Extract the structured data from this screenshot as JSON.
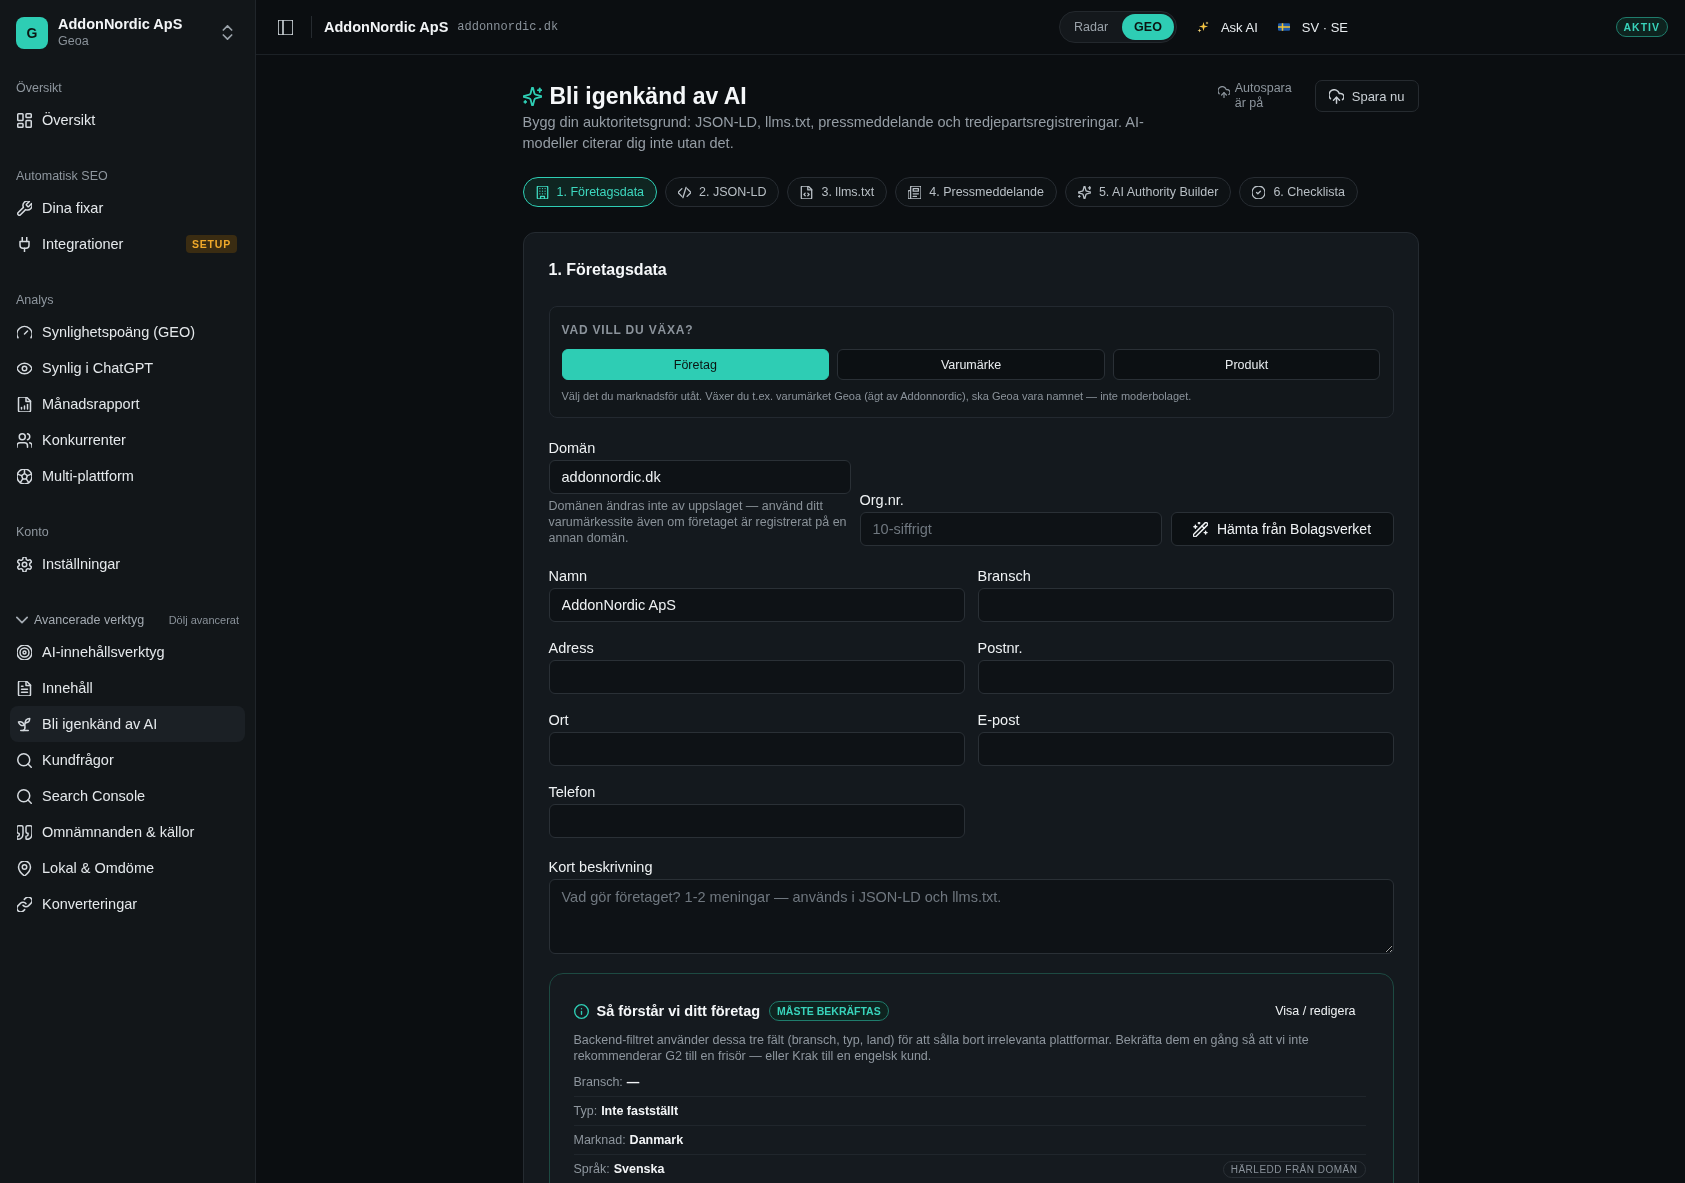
{
  "sidebar": {
    "workspace": {
      "initial": "G",
      "name": "AddonNordic ApS",
      "subtitle": "Geoa"
    },
    "sections": [
      {
        "title": "Översikt",
        "items": [
          {
            "label": "Översikt",
            "selected": false
          }
        ]
      },
      {
        "title": "Automatisk SEO",
        "items": [
          {
            "label": "Dina fixar",
            "selected": false
          },
          {
            "label": "Integrationer",
            "selected": false,
            "badge": "SETUP"
          }
        ]
      },
      {
        "title": "Analys",
        "items": [
          {
            "label": "Synlighetspoäng (GEO)",
            "selected": false
          },
          {
            "label": "Synlig i ChatGPT",
            "selected": false
          },
          {
            "label": "Månadsrapport",
            "selected": false
          },
          {
            "label": "Konkurrenter",
            "selected": false
          },
          {
            "label": "Multi-plattform",
            "selected": false
          }
        ]
      },
      {
        "title": "Konto",
        "items": [
          {
            "label": "Inställningar",
            "selected": false
          }
        ]
      }
    ],
    "advanced": {
      "title": "Avancerade verktyg",
      "expanded": true,
      "toggle": "Dölj avancerat",
      "items": [
        {
          "label": "AI-innehållsverktyg",
          "selected": false
        },
        {
          "label": "Innehåll",
          "selected": false
        },
        {
          "label": "Bli igenkänd av AI",
          "selected": true
        },
        {
          "label": "Kundfrågor",
          "selected": false
        },
        {
          "label": "Search Console",
          "selected": false
        },
        {
          "label": "Omnämnanden & källor",
          "selected": false
        },
        {
          "label": "Lokal & Omdöme",
          "selected": false
        },
        {
          "label": "Konverteringar",
          "selected": false
        }
      ]
    }
  },
  "top_bar": {
    "title": "AddonNordic ApS",
    "domain": "addonnordic.dk",
    "mode_switch": [
      {
        "label": "Radar",
        "selected": false
      },
      {
        "label": "GEO",
        "selected": true
      }
    ],
    "ask_ai": "Ask AI",
    "language": "SV · SE",
    "status": "AKTIV"
  },
  "header": {
    "title": "Bli igenkänd av AI",
    "description": "Bygg din auktoritetsgrund: JSON-LD, llms.txt, pressmeddelande och tredjepartsregistreringar. AI-modeller citerar dig inte utan det.",
    "autosave": "Autospara är på",
    "save_button": "Spara nu"
  },
  "tabs": [
    {
      "label": "1. Företagsdata",
      "selected": true
    },
    {
      "label": "2. JSON-LD",
      "selected": false
    },
    {
      "label": "3. llms.txt",
      "selected": false
    },
    {
      "label": "4. Pressmeddelande",
      "selected": false
    },
    {
      "label": "5. AI Authority Builder",
      "selected": false
    },
    {
      "label": "6. Checklista",
      "selected": false
    }
  ],
  "panel": {
    "title": "1. Företagsdata",
    "growth": {
      "heading": "VAD VILL DU VÄXA?",
      "options": [
        {
          "label": "Företag",
          "selected": true
        },
        {
          "label": "Varumärke",
          "selected": false
        },
        {
          "label": "Produkt",
          "selected": false
        }
      ],
      "hint": "Välj det du marknadsför utåt. Växer du t.ex. varumärket Geoa (ägt av Addonnordic), ska Geoa vara namnet — inte moderbolaget."
    },
    "domain": {
      "label": "Domän",
      "value": "addonnordic.dk",
      "help": "Domänen ändras inte av uppslaget — använd ditt varumärkessite även om företaget är registrerat på en annan domän."
    },
    "org_nr": {
      "label": "Org.nr.",
      "placeholder": "10-siffrigt"
    },
    "fetch_button": "Hämta från Bolagsverket",
    "fields": [
      {
        "label": "Namn",
        "value": "AddonNordic ApS"
      },
      {
        "label": "Bransch"
      },
      {
        "label": "Adress"
      },
      {
        "label": "Postnr."
      },
      {
        "label": "Ort"
      },
      {
        "label": "E-post"
      },
      {
        "label": "Telefon"
      }
    ],
    "description": {
      "label": "Kort beskrivning",
      "placeholder": "Vad gör företaget? 1-2 meningar — används i JSON-LD och llms.txt."
    },
    "understanding": {
      "title": "Så förstår vi ditt företag",
      "badge": "MÅSTE BEKRÄFTAS",
      "link": "Visa / redigera",
      "description": "Backend-filtret använder dessa tre fält (bransch, typ, land) för att sålla bort irrelevanta plattformar. Bekräfta dem en gång så att vi inte rekommenderar G2 till en frisör — eller Krak till en engelsk kund.",
      "facts": [
        {
          "label": "Bransch:",
          "value": "—"
        },
        {
          "label": "Typ:",
          "value": "Inte fastställt"
        },
        {
          "label": "Marknad:",
          "value": "Danmark"
        },
        {
          "label": "Språk:",
          "value": "Svenska",
          "badge": "HÄRLEDD FRÅN DOMÄN"
        }
      ]
    }
  }
}
